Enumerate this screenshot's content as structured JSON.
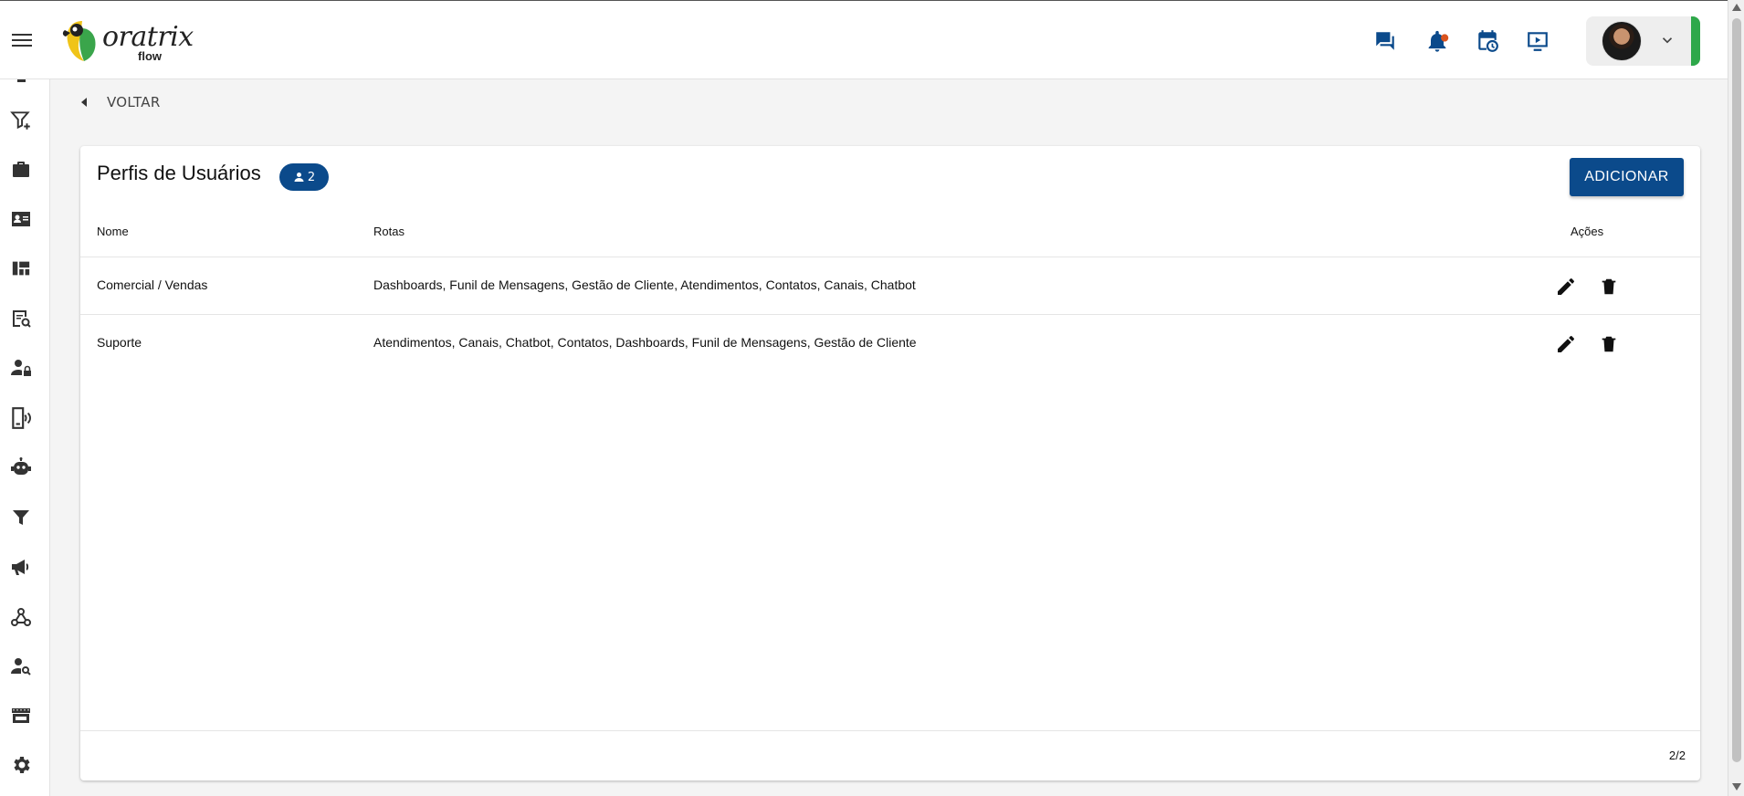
{
  "brand": {
    "logo_text": "oratrix",
    "logo_sub": "flow"
  },
  "header": {
    "icons": [
      "chat-icon",
      "notification-bell-icon",
      "calendar-clock-icon",
      "video-screen-icon"
    ],
    "accent_color": "#0b4a8b",
    "status_color": "#2ea84a"
  },
  "sidebar": {
    "items": [
      "filter-add-icon",
      "briefcase-icon",
      "contact-card-icon",
      "dashboard-icon",
      "document-search-icon",
      "user-lock-icon",
      "phone-signal-icon",
      "robot-icon",
      "filter-icon",
      "megaphone-icon",
      "webhook-icon",
      "user-search-icon",
      "store-icon",
      "settings-gear-icon"
    ]
  },
  "nav": {
    "back_label": "VOLTAR"
  },
  "card": {
    "title": "Perfis de Usuários",
    "count": "2",
    "add_label": "ADICIONAR",
    "columns": {
      "name": "Nome",
      "routes": "Rotas",
      "actions": "Ações"
    },
    "rows": [
      {
        "name": "Comercial / Vendas",
        "routes": "Dashboards, Funil de Mensagens, Gestão de Cliente, Atendimentos, Contatos, Canais, Chatbot"
      },
      {
        "name": "Suporte",
        "routes": "Atendimentos, Canais, Chatbot, Contatos, Dashboards, Funil de Mensagens, Gestão de Cliente"
      }
    ],
    "pagination": "2/2"
  }
}
